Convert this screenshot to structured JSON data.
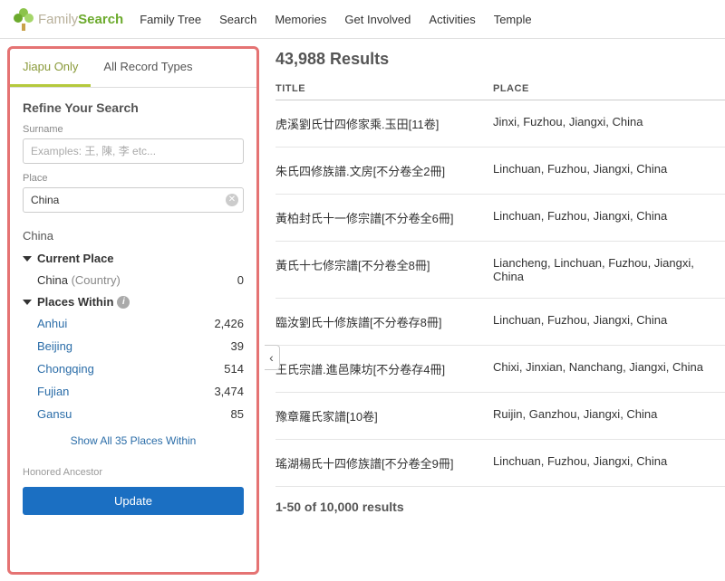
{
  "nav": {
    "brand_family": "Family",
    "brand_search": "Search",
    "links": [
      "Family Tree",
      "Search",
      "Memories",
      "Get Involved",
      "Activities",
      "Temple"
    ]
  },
  "sidebar": {
    "tabs": {
      "jiapu": "Jiapu Only",
      "all": "All Record Types"
    },
    "refine_title": "Refine Your Search",
    "surname_label": "Surname",
    "surname_placeholder": "Examples: 王, 陳, 李 etc...",
    "place_label": "Place",
    "place_value": "China",
    "place_heading": "China",
    "current_place_label": "Current Place",
    "current_place_item": {
      "name": "China",
      "qualifier": "(Country)",
      "count": "0"
    },
    "places_within_label": "Places Within",
    "places_within": [
      {
        "name": "Anhui",
        "count": "2,426"
      },
      {
        "name": "Beijing",
        "count": "39"
      },
      {
        "name": "Chongqing",
        "count": "514"
      },
      {
        "name": "Fujian",
        "count": "3,474"
      },
      {
        "name": "Gansu",
        "count": "85"
      }
    ],
    "show_all": "Show All 35 Places Within",
    "honored_label": "Honored Ancestor",
    "update_label": "Update"
  },
  "results": {
    "heading": "43,988 Results",
    "col_title": "TITLE",
    "col_place": "PLACE",
    "rows": [
      {
        "title": "虎溪劉氏廿四修家乘.玉田[11卷]",
        "place": "Jinxi, Fuzhou, Jiangxi, China"
      },
      {
        "title": "朱氏四修族譜.文房[不分卷全2冊]",
        "place": "Linchuan, Fuzhou, Jiangxi, China"
      },
      {
        "title": "黃柏封氏十一修宗譜[不分卷全6冊]",
        "place": "Linchuan, Fuzhou, Jiangxi, China"
      },
      {
        "title": "黃氏十七修宗譜[不分卷全8冊]",
        "place": "Liancheng, Linchuan, Fuzhou, Jiangxi, China"
      },
      {
        "title": "臨汝劉氏十修族譜[不分卷存8冊]",
        "place": "Linchuan, Fuzhou, Jiangxi, China"
      },
      {
        "title": "王氏宗譜.進邑陳坊[不分卷存4冊]",
        "place": "Chixi, Jinxian, Nanchang, Jiangxi, China"
      },
      {
        "title": "豫章羅氏家譜[10卷]",
        "place": "Ruijin, Ganzhou, Jiangxi, China"
      },
      {
        "title": "瑤湖楊氏十四修族譜[不分卷全9冊]",
        "place": "Linchuan, Fuzhou, Jiangxi, China"
      }
    ],
    "pagination": "1-50 of 10,000 results"
  }
}
